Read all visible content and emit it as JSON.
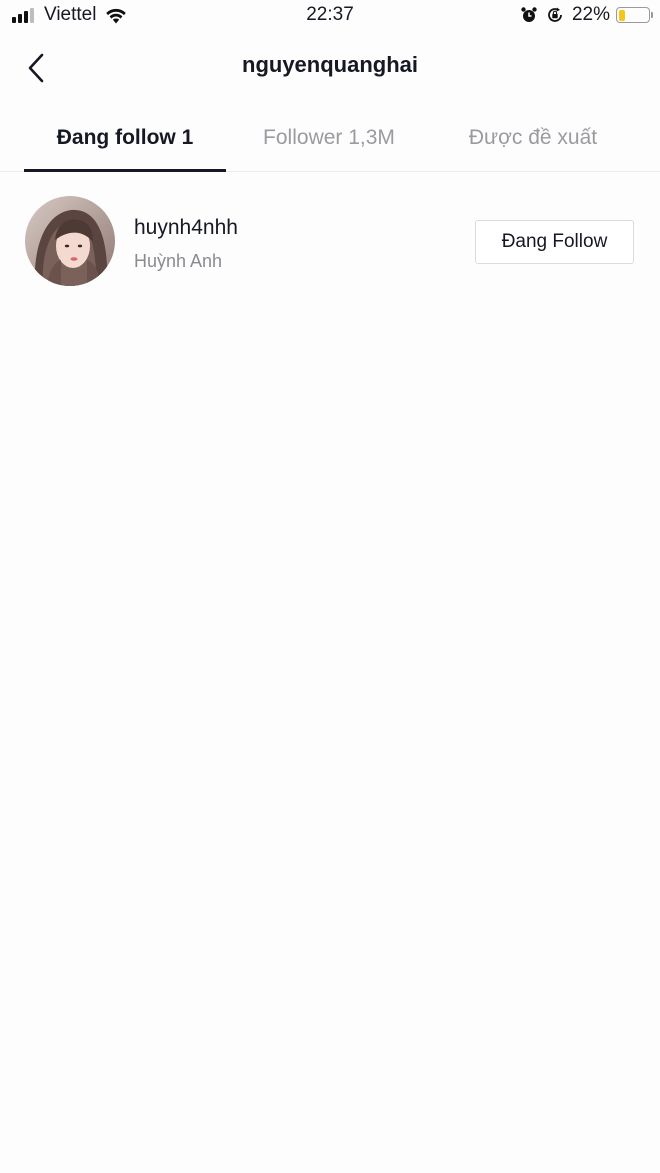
{
  "status_bar": {
    "carrier": "Viettel",
    "time": "22:37",
    "battery_percent": "22%",
    "battery_level": 0.22,
    "battery_color": "#f5c518",
    "icons": [
      "signal-icon",
      "wifi-icon",
      "alarm-icon",
      "orientation-lock-icon",
      "battery-icon"
    ]
  },
  "header": {
    "title": "nguyenquanghai",
    "back_icon": "chevron-left-icon"
  },
  "tabs": [
    {
      "label": "Đang follow 1",
      "active": true
    },
    {
      "label": "Follower 1,3M",
      "active": false
    },
    {
      "label": "Được đề xuất",
      "active": false
    }
  ],
  "following_list": [
    {
      "username": "huynh4nhh",
      "display_name": "Huỳnh Anh",
      "button_label": "Đang Follow"
    }
  ],
  "colors": {
    "primary_text": "#161823",
    "secondary_text": "#8a8b91",
    "inactive_tab": "#9a9ba0"
  }
}
